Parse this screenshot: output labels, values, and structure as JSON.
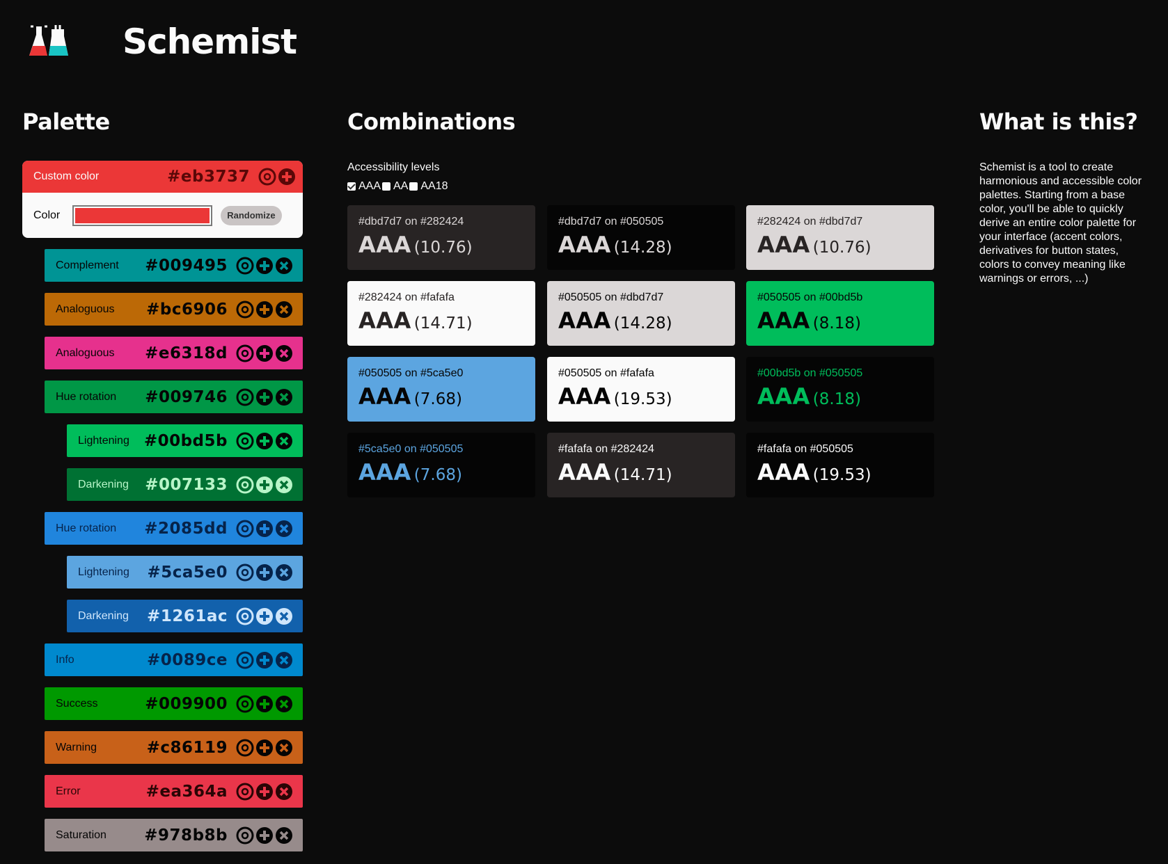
{
  "app": {
    "title": "Schemist"
  },
  "palette": {
    "title": "Palette",
    "custom": {
      "label": "Custom color",
      "hex": "#eb3737",
      "color_label": "Color",
      "value": "#eb3737",
      "randomize_label": "Randomize"
    },
    "rows": [
      {
        "label": "Complement",
        "hex": "#009495",
        "bg": "#009495",
        "fg": "#050505",
        "indent": 1
      },
      {
        "label": "Analoguous",
        "hex": "#bc6906",
        "bg": "#bc6906",
        "fg": "#050505",
        "indent": 1
      },
      {
        "label": "Analoguous",
        "hex": "#e6318d",
        "bg": "#e6318d",
        "fg": "#050505",
        "indent": 1
      },
      {
        "label": "Hue rotation",
        "hex": "#009746",
        "bg": "#009746",
        "fg": "#050505",
        "indent": 1
      },
      {
        "label": "Lightening",
        "hex": "#00bd5b",
        "bg": "#00bd5b",
        "fg": "#050505",
        "indent": 2
      },
      {
        "label": "Darkening",
        "hex": "#007133",
        "bg": "#007133",
        "fg": "#b8f5c8",
        "indent": 2
      },
      {
        "label": "Hue rotation",
        "hex": "#2085dd",
        "bg": "#2085dd",
        "fg": "#06234a",
        "indent": 1
      },
      {
        "label": "Lightening",
        "hex": "#5ca5e0",
        "bg": "#5ca5e0",
        "fg": "#06234a",
        "indent": 2
      },
      {
        "label": "Darkening",
        "hex": "#1261ac",
        "bg": "#1261ac",
        "fg": "#cfe6fb",
        "indent": 2
      },
      {
        "label": "Info",
        "hex": "#0089ce",
        "bg": "#0089ce",
        "fg": "#06234a",
        "indent": 1
      },
      {
        "label": "Success",
        "hex": "#009900",
        "bg": "#009900",
        "fg": "#050505",
        "indent": 1
      },
      {
        "label": "Warning",
        "hex": "#c86119",
        "bg": "#c86119",
        "fg": "#050505",
        "indent": 1
      },
      {
        "label": "Error",
        "hex": "#ea364a",
        "bg": "#ea364a",
        "fg": "#2a0505",
        "indent": 1
      },
      {
        "label": "Saturation",
        "hex": "#978b8b",
        "bg": "#978b8b",
        "fg": "#050505",
        "indent": 1
      }
    ]
  },
  "combinations": {
    "title": "Combinations",
    "accessibility_label": "Accessibility levels",
    "levels": [
      {
        "label": "AAA",
        "checked": true
      },
      {
        "label": "AA",
        "checked": false
      },
      {
        "label": "AA18",
        "checked": false
      }
    ],
    "cards": [
      {
        "desc": "#dbd7d7 on #282424",
        "level": "AAA",
        "ratio": "(10.76)",
        "fg": "#dbd7d7",
        "bg": "#282424"
      },
      {
        "desc": "#dbd7d7 on #050505",
        "level": "AAA",
        "ratio": "(14.28)",
        "fg": "#dbd7d7",
        "bg": "#050505"
      },
      {
        "desc": "#282424 on #dbd7d7",
        "level": "AAA",
        "ratio": "(10.76)",
        "fg": "#282424",
        "bg": "#dbd7d7"
      },
      {
        "desc": "#282424 on #fafafa",
        "level": "AAA",
        "ratio": "(14.71)",
        "fg": "#282424",
        "bg": "#fafafa"
      },
      {
        "desc": "#050505 on #dbd7d7",
        "level": "AAA",
        "ratio": "(14.28)",
        "fg": "#050505",
        "bg": "#dbd7d7"
      },
      {
        "desc": "#050505 on #00bd5b",
        "level": "AAA",
        "ratio": "(8.18)",
        "fg": "#050505",
        "bg": "#00bd5b"
      },
      {
        "desc": "#050505 on #5ca5e0",
        "level": "AAA",
        "ratio": "(7.68)",
        "fg": "#050505",
        "bg": "#5ca5e0"
      },
      {
        "desc": "#050505 on #fafafa",
        "level": "AAA",
        "ratio": "(19.53)",
        "fg": "#050505",
        "bg": "#fafafa"
      },
      {
        "desc": "#00bd5b on #050505",
        "level": "AAA",
        "ratio": "(8.18)",
        "fg": "#00bd5b",
        "bg": "#050505"
      },
      {
        "desc": "#5ca5e0 on #050505",
        "level": "AAA",
        "ratio": "(7.68)",
        "fg": "#5ca5e0",
        "bg": "#050505"
      },
      {
        "desc": "#fafafa on #282424",
        "level": "AAA",
        "ratio": "(14.71)",
        "fg": "#fafafa",
        "bg": "#282424"
      },
      {
        "desc": "#fafafa on #050505",
        "level": "AAA",
        "ratio": "(19.53)",
        "fg": "#fafafa",
        "bg": "#050505"
      }
    ]
  },
  "about": {
    "title": "What is this?",
    "text": "Schemist is a tool to create harmonious and accessible color palettes. Starting from a base color, you'll be able to quickly derive an entire color palette for your interface (accent colors, derivatives for button states, colors to convey meaning like warnings or errors, ...)"
  },
  "icons": [
    "settings-icon",
    "add-icon",
    "remove-icon"
  ]
}
